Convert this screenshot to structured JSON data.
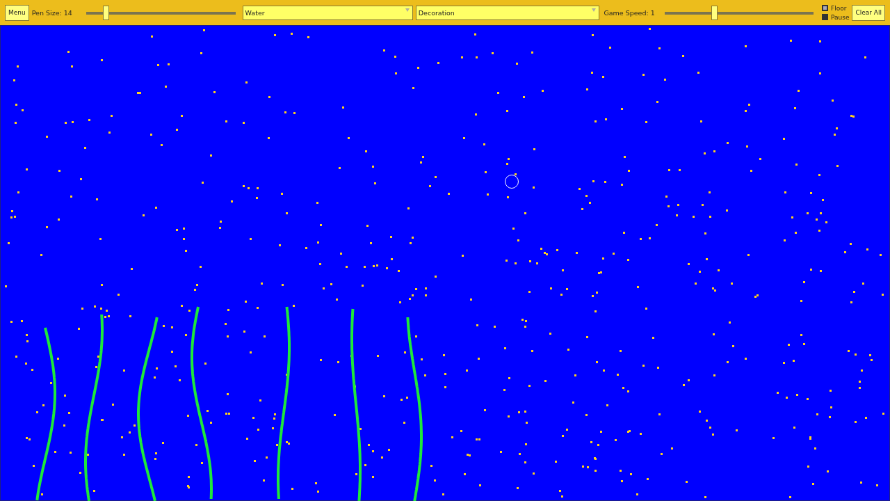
{
  "toolbar": {
    "menu_button": "Menu",
    "pen_size": {
      "label": "Pen Size: 14",
      "level": 0.13
    },
    "element_select": {
      "value": "Water"
    },
    "category_select": {
      "value": "Decoration"
    },
    "game_speed": {
      "label": "Game Speed: 1",
      "level": 0.33
    },
    "toggles": [
      {
        "label": "Floor",
        "checked": true
      },
      {
        "label": "Pause",
        "checked": false
      }
    ],
    "clear_button": "Clear All"
  }
}
